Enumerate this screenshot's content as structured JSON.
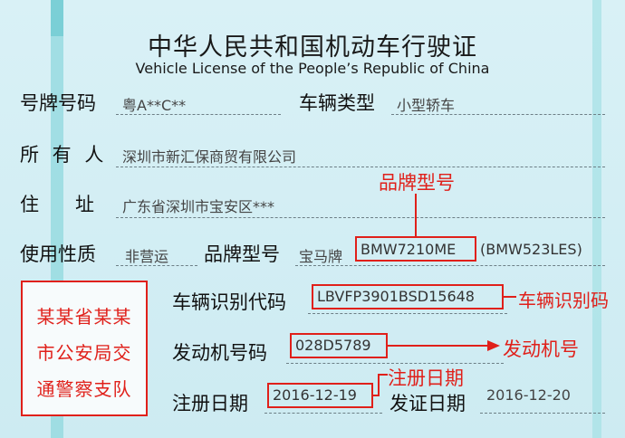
{
  "title_cn": "中华人民共和国机动车行驶证",
  "title_en": "Vehicle License of the People’s Republic of China",
  "rows": {
    "plate_label": "号牌号码",
    "plate_value": "粤A**C**",
    "type_label": "车辆类型",
    "type_value": "小型轿车",
    "owner_label": "所 有 人",
    "owner_value": "深圳市新汇保商贸有限公司",
    "address_label": "住      址",
    "address_value": "广东省深圳市宝安区***",
    "use_label": "使用性质",
    "use_value": "非营运",
    "brand_label": "品牌型号",
    "brand_prefix": "宝马牌",
    "brand_model": "BMW7210ME",
    "brand_suffix": "(BMW523LES)",
    "vin_label": "车辆识别代码",
    "vin_value": "LBVFP3901BSD15648",
    "engine_label": "发动机号码",
    "engine_value": "028D5789",
    "reg_label": "注册日期",
    "reg_value": "2016-12-19",
    "issue_label": "发证日期",
    "issue_value": "2016-12-20"
  },
  "seal": {
    "line1": "某某省某某",
    "line2": "市公安局交",
    "line3": "通警察支队"
  },
  "annotations": {
    "brand": "品牌型号",
    "vin": "车辆识别码",
    "engine": "发动机号",
    "reg": "注册日期"
  },
  "colors": {
    "annotation_red": "#e0201a",
    "stripe": "#8fd8de",
    "background": "#d3edf3"
  }
}
